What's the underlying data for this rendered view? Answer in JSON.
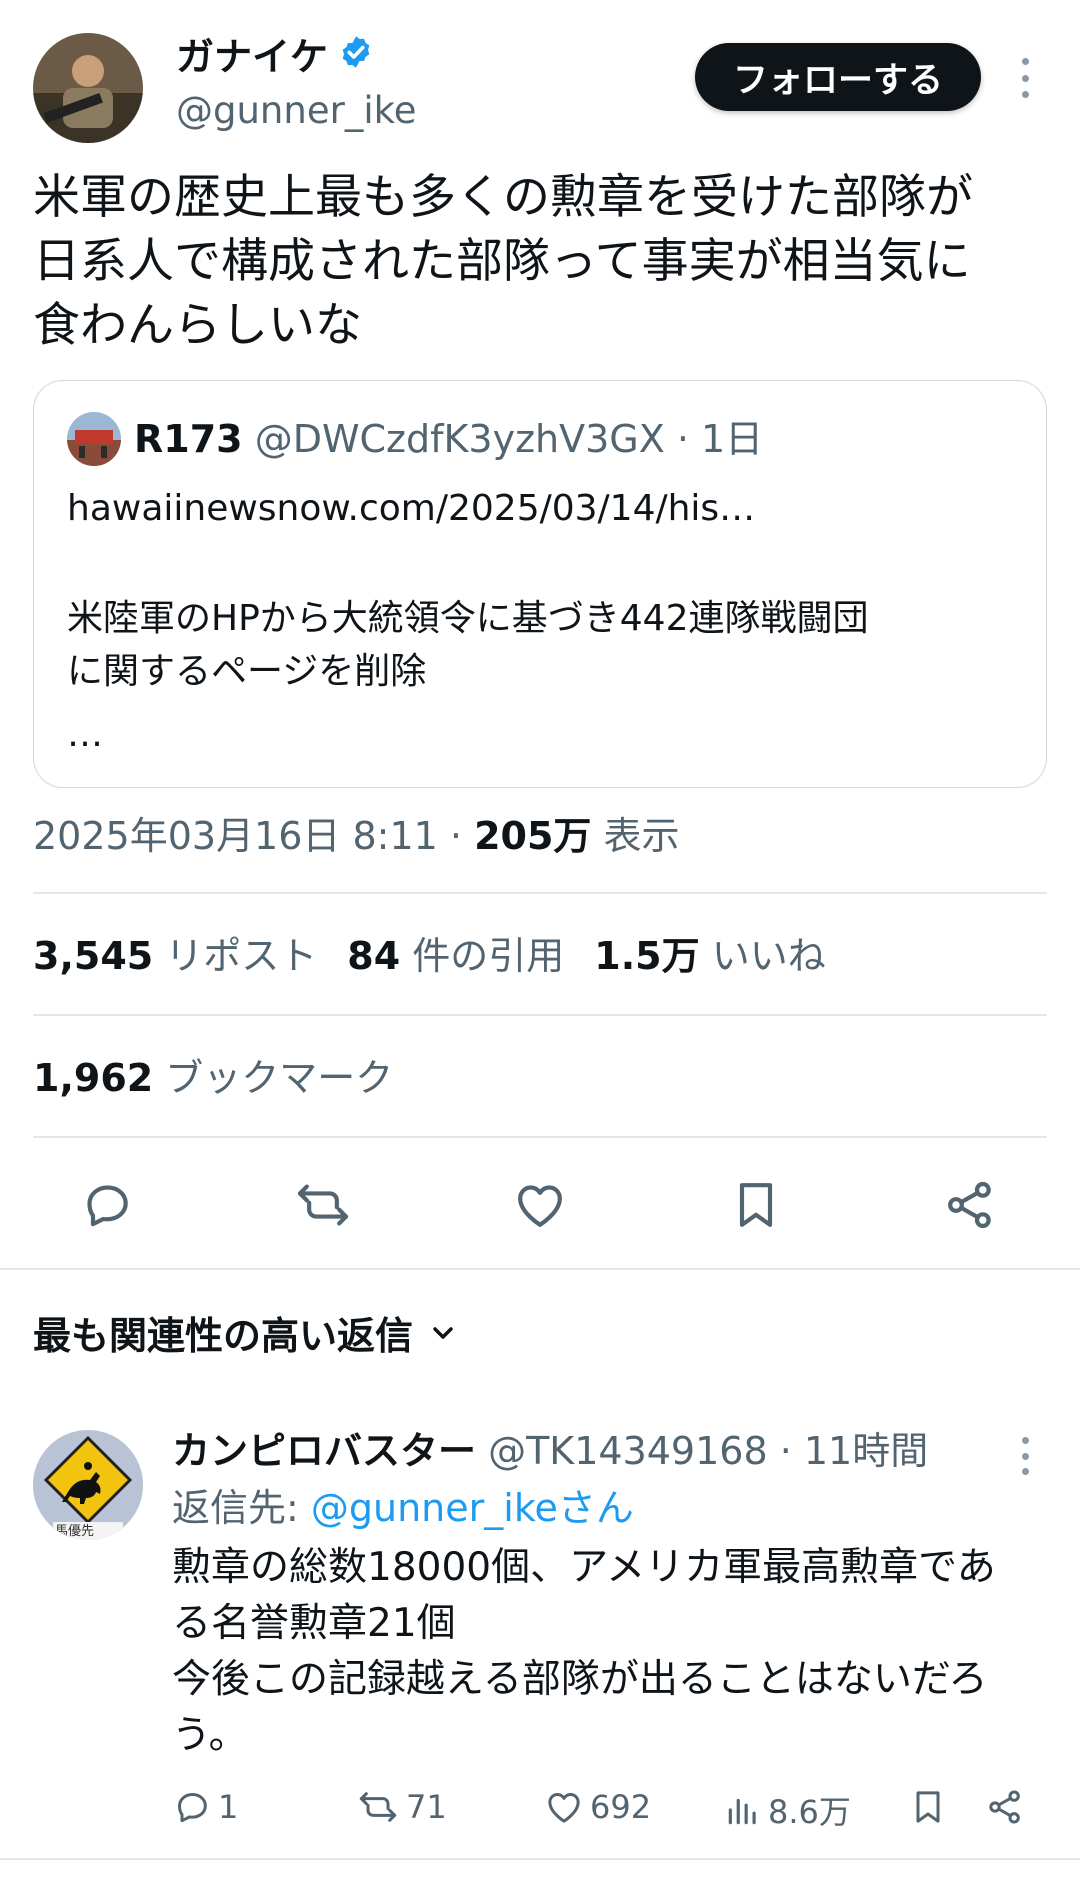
{
  "tweet": {
    "author": {
      "name": "ガナイケ",
      "handle": "@gunner_ike",
      "verified": true
    },
    "follow_label": "フォローする",
    "text_lines": [
      "米軍の歴史上最も多くの勲章を受けた部隊が",
      "日系人で構成された部隊って事実が相当気に",
      "食わんらしいな"
    ],
    "quote": {
      "name": "R173",
      "handle_time": "@DWCzdfK3yzhV3GX · 1日",
      "link": "hawaiinewsnow.com/2025/03/14/his…",
      "lines": [
        "米陸軍のHPから大統領令に基づき442連隊戦闘団",
        "に関するページを削除",
        "…"
      ]
    },
    "timestamp": "2025年03月16日 8:11 · ",
    "views_count": "205万",
    "views_label": " 表示",
    "stats": {
      "reposts_count": "3,545",
      "reposts_label": " リポスト",
      "quotes_count": "84",
      "quotes_label": " 件の引用",
      "likes_count": "1.5万",
      "likes_label": " いいね",
      "bookmarks_count": "1,962",
      "bookmarks_label": " ブックマーク"
    },
    "actions": [
      "reply-icon",
      "repost-icon",
      "like-icon",
      "bookmark-icon",
      "share-icon"
    ]
  },
  "replies_section": {
    "title": "最も関連性の高い返信"
  },
  "reply": {
    "name": "カンピロバスター",
    "handle_time": " @TK14349168 · 11時間",
    "reply_to_prefix": "返信先: ",
    "reply_to_handle": "@gunner_ikeさん",
    "avatar_sign_text": "馬優先",
    "text_lines": [
      "勲章の総数18000個、アメリカ軍最高勲章であ",
      "る名誉勲章21個",
      "今後この記録越える部隊が出ることはないだろ",
      "う。"
    ],
    "counts": {
      "replies": "1",
      "reposts": "71",
      "likes": "692",
      "views": "8.6万"
    }
  },
  "colors": {
    "accent": "#1d9bf0",
    "text": "#0f1419",
    "secondary": "#536471",
    "verified": "#1d9bf0"
  }
}
